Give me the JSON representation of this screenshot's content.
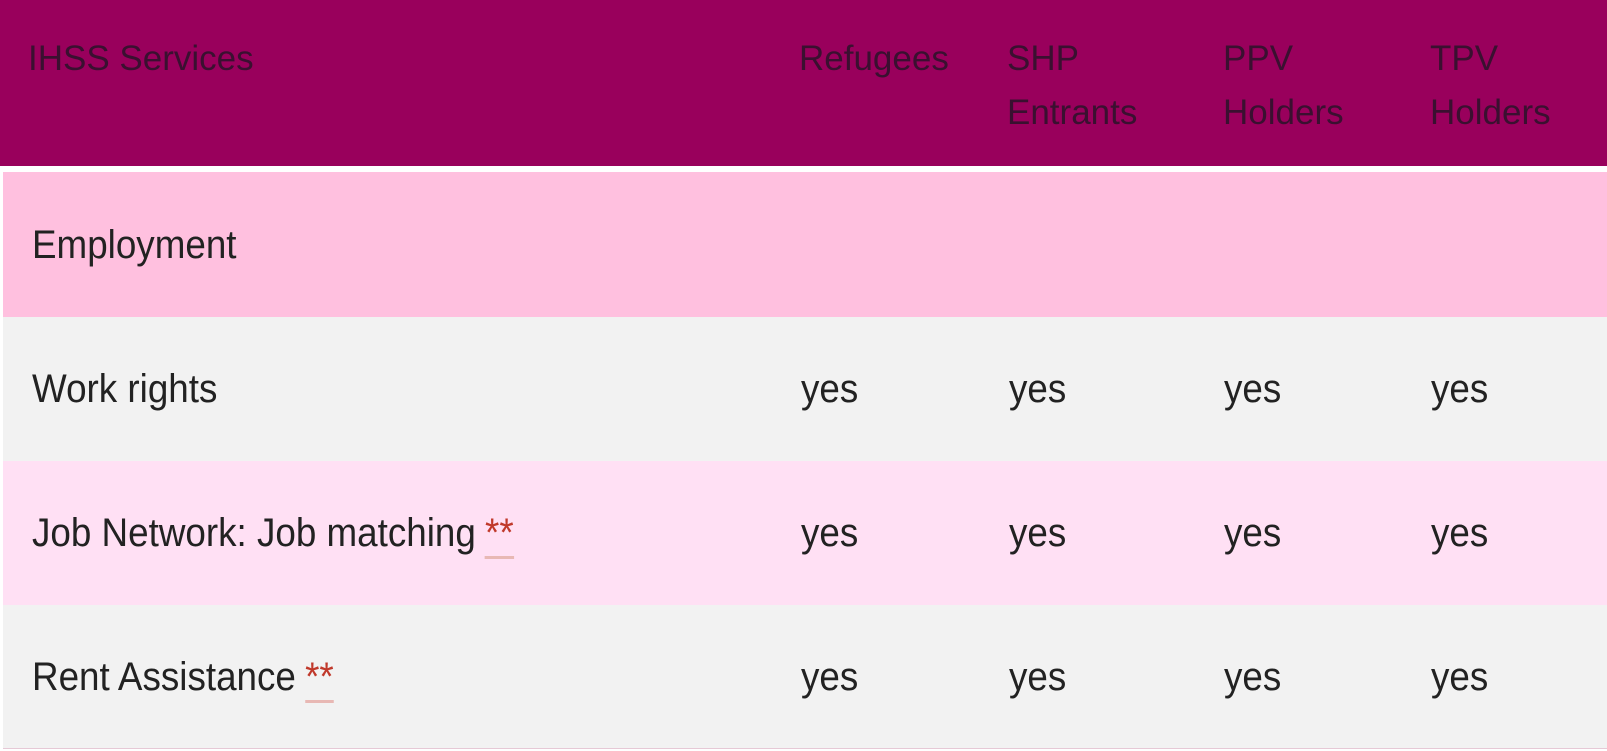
{
  "header": {
    "col0": "IHSS Services",
    "col1": "Refugees",
    "col2_line1": "SHP",
    "col2_line2": "Entrants",
    "col3_line1": "PPV",
    "col3_line2": "Holders",
    "col4_line1": "TPV",
    "col4_line2": "Holders"
  },
  "section": {
    "label": "Employment"
  },
  "rows": [
    {
      "service": "Work rights",
      "note": "",
      "values": [
        "yes",
        "yes",
        "yes",
        "yes"
      ]
    },
    {
      "service": "Job Network: Job matching",
      "note": "**",
      "values": [
        "yes",
        "yes",
        "yes",
        "yes"
      ]
    },
    {
      "service": "Rent Assistance",
      "note": "**",
      "values": [
        "yes",
        "yes",
        "yes",
        "yes"
      ]
    }
  ],
  "colors": {
    "header_bg": "#99005c",
    "section_bg": "#ffc0df",
    "row_gray": "#f2f2f2",
    "row_pink": "#ffe0f4",
    "asterisk": "#c0392b"
  }
}
